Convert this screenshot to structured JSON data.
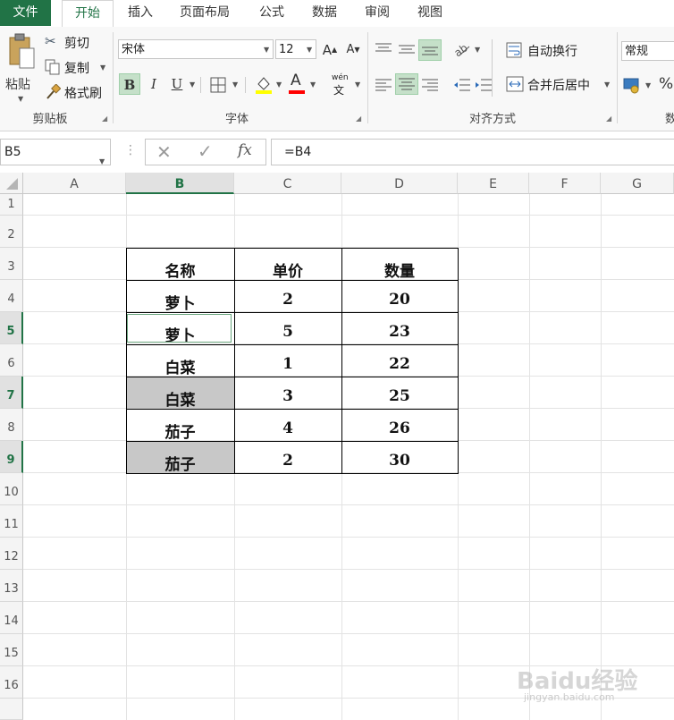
{
  "ribbon": {
    "tabs": [
      "文件",
      "开始",
      "插入",
      "页面布局",
      "公式",
      "数据",
      "审阅",
      "视图"
    ],
    "clipboard": {
      "paste": "粘贴",
      "cut": "剪切",
      "copy": "复制",
      "format_painter": "格式刷",
      "title": "剪贴板"
    },
    "font": {
      "name": "宋体",
      "size": "12",
      "grow_symbol": "A",
      "shrink_symbol": "A",
      "bold": "B",
      "italic": "I",
      "underline": "U",
      "font_color_symbol": "A",
      "phonetic_top": "wén",
      "phonetic_bottom": "文",
      "title": "字体",
      "fill_color": "#ffff00",
      "font_color": "#ff0000"
    },
    "alignment": {
      "wrap_text": "自动换行",
      "merge_center": "合并后居中",
      "title": "对齐方式"
    },
    "number": {
      "format": "常规",
      "percent_symbol": "%",
      "title_partial": "数"
    }
  },
  "formula_bar": {
    "name_box": "B5",
    "fx_symbol": "fx",
    "formula": "=B4"
  },
  "sheet": {
    "columns": [
      "A",
      "B",
      "C",
      "D",
      "E",
      "F",
      "G"
    ],
    "selected_column": "B",
    "rows": [
      "1",
      "2",
      "3",
      "4",
      "5",
      "6",
      "7",
      "8",
      "9",
      "10",
      "11",
      "12",
      "13",
      "14",
      "15",
      "16"
    ],
    "selected_rows": [
      "5",
      "7",
      "9"
    ],
    "active_cell": "B5",
    "table": {
      "headers": [
        "名称",
        "单价",
        "数量"
      ],
      "rows": [
        {
          "name": "萝卜",
          "price": "2",
          "qty": "20"
        },
        {
          "name": "萝卜",
          "price": "5",
          "qty": "23"
        },
        {
          "name": "白菜",
          "price": "1",
          "qty": "22"
        },
        {
          "name": "白菜",
          "price": "3",
          "qty": "25"
        },
        {
          "name": "茄子",
          "price": "4",
          "qty": "26"
        },
        {
          "name": "茄子",
          "price": "2",
          "qty": "30"
        }
      ],
      "gray_fill": "#c8c8c8"
    }
  },
  "colors": {
    "accent": "#217346"
  },
  "watermark": {
    "brand": "Baidu经验",
    "url": "jingyan.baidu.com"
  }
}
